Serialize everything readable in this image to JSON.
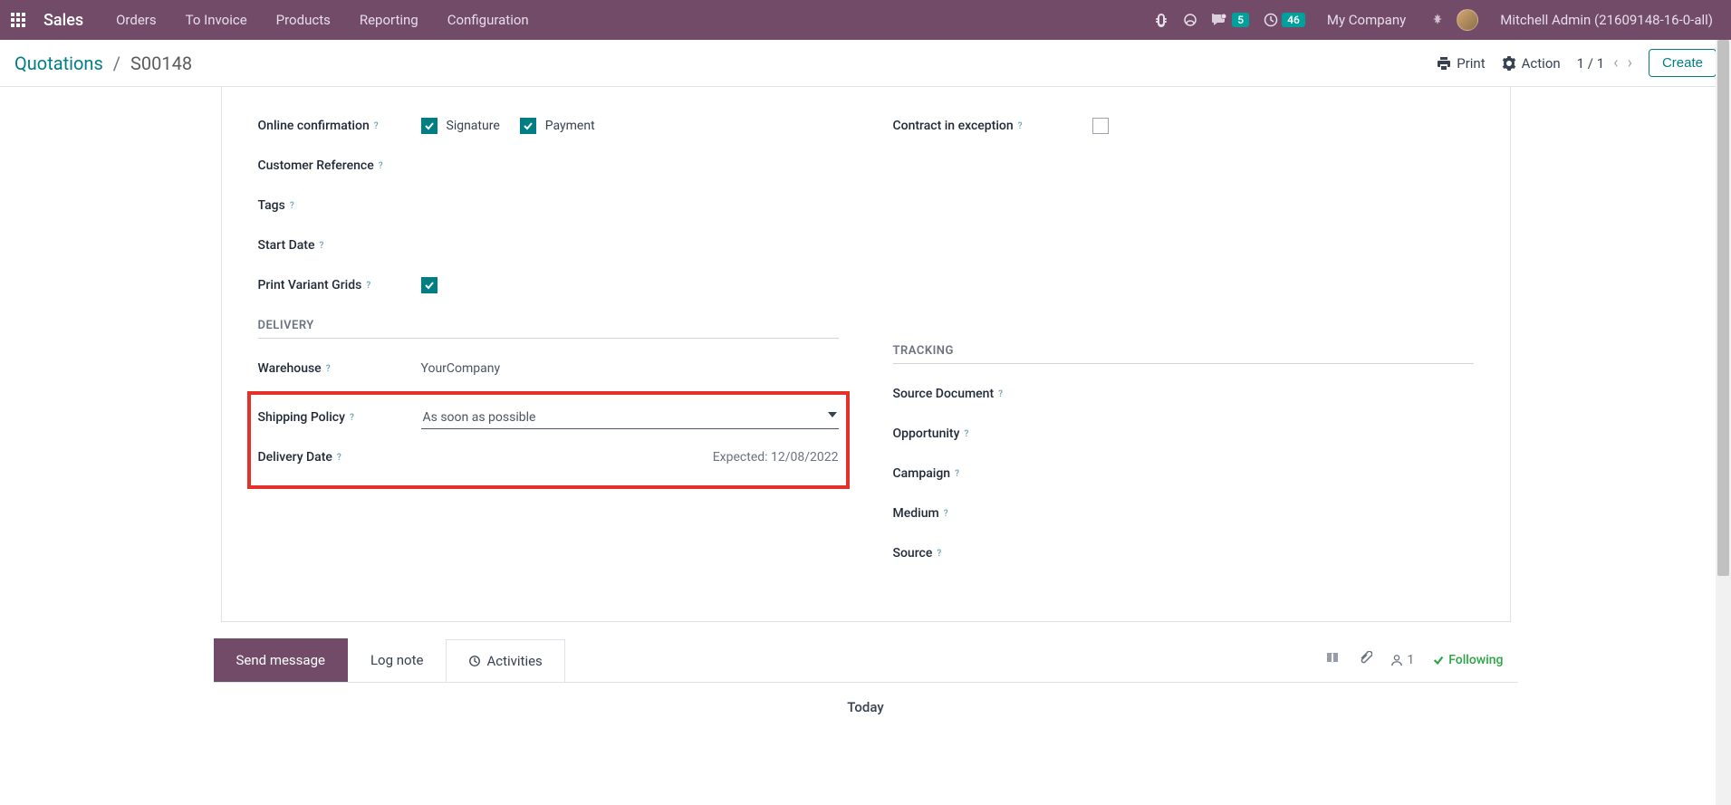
{
  "nav": {
    "brand": "Sales",
    "links": [
      "Orders",
      "To Invoice",
      "Products",
      "Reporting",
      "Configuration"
    ],
    "messages_badge": "5",
    "activities_badge": "46",
    "company": "My Company",
    "user": "Mitchell Admin (21609148-16-0-all)"
  },
  "actionbar": {
    "breadcrumb_root": "Quotations",
    "breadcrumb_current": "S00148",
    "print": "Print",
    "action": "Action",
    "pager": "1 / 1",
    "create": "Create"
  },
  "form": {
    "online_confirmation_label": "Online confirmation",
    "signature_label": "Signature",
    "payment_label": "Payment",
    "customer_reference_label": "Customer Reference",
    "tags_label": "Tags",
    "start_date_label": "Start Date",
    "print_variant_grids_label": "Print Variant Grids",
    "contract_in_exception_label": "Contract in exception",
    "delivery_section": "DELIVERY",
    "warehouse_label": "Warehouse",
    "warehouse_value": "YourCompany",
    "shipping_policy_label": "Shipping Policy",
    "shipping_policy_value": "As soon as possible",
    "delivery_date_label": "Delivery Date",
    "delivery_date_expected": "Expected: 12/08/2022",
    "tracking_section": "TRACKING",
    "source_document_label": "Source Document",
    "opportunity_label": "Opportunity",
    "campaign_label": "Campaign",
    "medium_label": "Medium",
    "source_label": "Source"
  },
  "chatter": {
    "send_message": "Send message",
    "log_note": "Log note",
    "activities": "Activities",
    "followers": "1",
    "following": "Following",
    "today": "Today"
  }
}
